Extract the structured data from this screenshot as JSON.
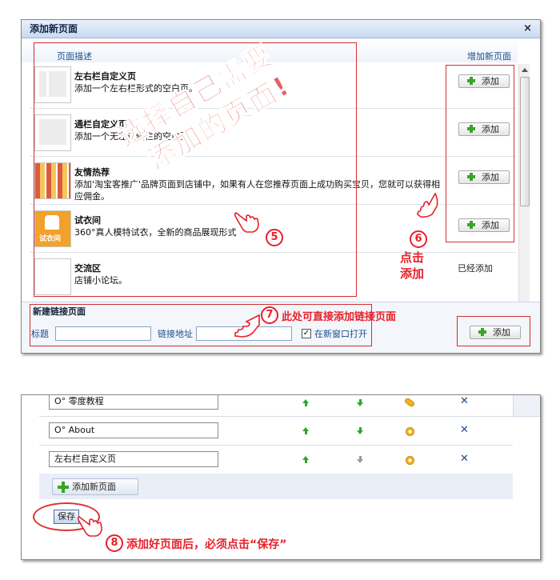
{
  "dialog": {
    "title": "添加新页面",
    "close_glyph": "×",
    "header_left": "页面描述",
    "header_right": "增加新页面",
    "rows": [
      {
        "title": "左右栏自定义页",
        "desc": "添加一个左右栏形式的空白页。",
        "action": "添加"
      },
      {
        "title": "通栏自定义页",
        "desc": "添加一个无左边侧栏的空白页。",
        "action": "添加"
      },
      {
        "title": "友情热荐",
        "desc": "添加'淘宝客推广'品牌页面到店铺中，如果有人在您推荐页面上成功购买宝贝，您就可以获得相",
        "desc2": "应佣金。",
        "action": "添加"
      },
      {
        "title": "试衣间",
        "desc": "360°真人模特试衣，全新的商品展现形式",
        "thumb_label": "试衣间",
        "action": "添加"
      },
      {
        "title": "交流区",
        "desc": "店铺小论坛。",
        "action": "已经添加"
      }
    ],
    "link_section": {
      "heading": "新建链接页面",
      "title_label": "标题",
      "url_label": "链接地址",
      "checkbox_label": "在新窗口打开",
      "checkbox_glyph": "✓",
      "add_label": "添加"
    }
  },
  "annotations": {
    "overlay_line1": "选择自己需要",
    "overlay_line2": "添加的页面!",
    "num5": "5",
    "num6": "6",
    "click_add_line1": "点击",
    "click_add_line2": "添加",
    "num7": "7",
    "anno7": "此处可直接添加链接页面",
    "num8": "8",
    "anno8": "添加好页面后，必须点击“保存”"
  },
  "page_list": {
    "rows": [
      {
        "name": "O° 零度教程"
      },
      {
        "name": "O°  About"
      },
      {
        "name": "左右栏自定义页"
      }
    ],
    "add_new_label": "添加新页面",
    "save_label": "保存"
  },
  "colors": {
    "accent_red": "#e8202a",
    "link_blue": "#1a4e8a",
    "plus_green": "#3aa52a"
  }
}
